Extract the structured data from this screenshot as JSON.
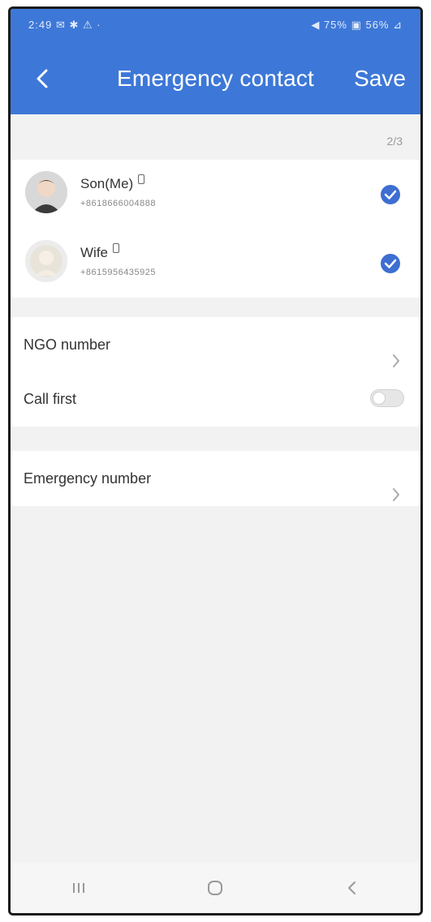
{
  "statusbar": {
    "time": "2:49",
    "left_icons": "✉ ✱ ⚠ ·",
    "right_text": "◀ 75% ▣ 56% ⊿"
  },
  "header": {
    "back_icon": "chevron-left-icon",
    "title": "Emergency contact",
    "save_label": "Save"
  },
  "counter": "2/3",
  "contacts": [
    {
      "name": "Son(Me)",
      "phone": "+8618666004888",
      "avatar": "person-avatar-icon",
      "checked": true
    },
    {
      "name": "Wife",
      "phone": "+8615956435925",
      "avatar": "person-avatar-icon",
      "checked": true
    }
  ],
  "settings": {
    "ngo_label": "NGO number",
    "call_first_label": "Call first",
    "call_first_on": false,
    "emergency_label": "Emergency number"
  },
  "colors": {
    "accent": "#3d78d8",
    "check": "#3d6ed1",
    "background": "#f2f2f2"
  },
  "bottom_nav": [
    "recent-apps-icon",
    "home-icon",
    "back-icon"
  ]
}
